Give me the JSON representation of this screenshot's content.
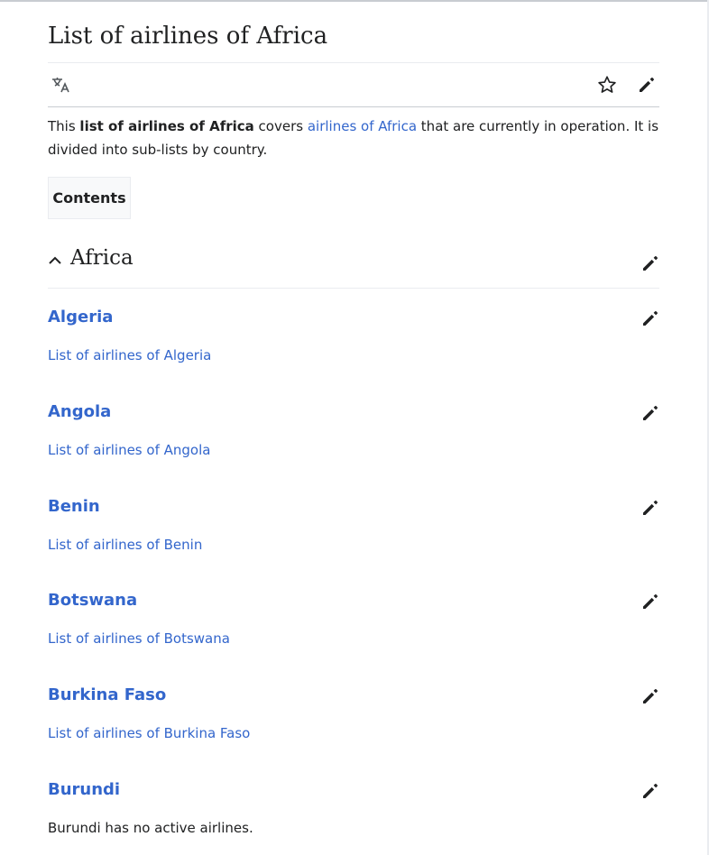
{
  "page": {
    "title": "List of airlines of Africa"
  },
  "toolbar": {
    "language_icon": "translate-icon",
    "watch_icon": "star-icon",
    "edit_icon": "pencil-icon"
  },
  "intro": {
    "prefix": "This ",
    "bold": "list of airlines of Africa",
    "middle": " covers ",
    "link": "airlines of Africa",
    "suffix": " that are currently in operation. It is divided into sub-lists by country."
  },
  "toc": {
    "label": "Contents"
  },
  "section": {
    "title": "Africa",
    "collapse_icon": "chevron-up-icon"
  },
  "countries": [
    {
      "name": "Algeria",
      "text": "List of airlines of Algeria",
      "is_link": true
    },
    {
      "name": "Angola",
      "text": "List of airlines of Angola",
      "is_link": true
    },
    {
      "name": "Benin",
      "text": "List of airlines of Benin",
      "is_link": true
    },
    {
      "name": "Botswana",
      "text": "List of airlines of Botswana",
      "is_link": true
    },
    {
      "name": "Burkina Faso",
      "text": "List of airlines of Burkina Faso",
      "is_link": true
    },
    {
      "name": "Burundi",
      "text": "Burundi has no active airlines.",
      "is_link": false
    }
  ],
  "colors": {
    "link": "#3366cc",
    "text": "#202122",
    "border": "#c8ccd1"
  }
}
